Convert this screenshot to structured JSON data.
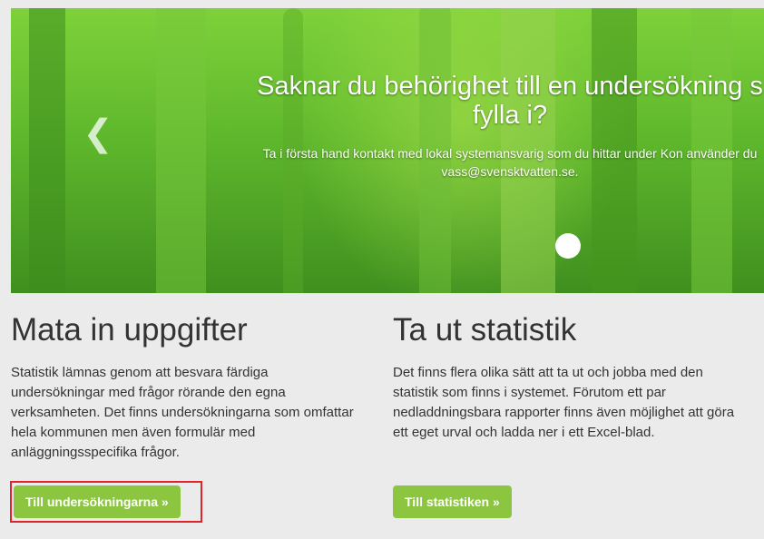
{
  "carousel": {
    "title": "Saknar du behörighet till en undersökning s fylla i?",
    "text": "Ta i första hand kontakt med lokal systemansvarig som du hittar under Kon använder du vass@svensktvatten.se."
  },
  "left": {
    "heading": "Mata in uppgifter",
    "body": "Statistik lämnas genom att besvara färdiga undersökningar med frågor rörande den egna verksamheten. Det finns undersökningarna som omfattar hela kommunen men även formulär med anläggningsspecifika frågor.",
    "button_label": "Till undersökningarna »"
  },
  "right": {
    "heading": "Ta ut statistik",
    "body": "Det finns flera olika sätt att ta ut och jobba med den statistik som finns i systemet. Förutom ett par nedladdningsbara rapporter finns även möjlighet att göra ett eget urval och ladda ner i ett Excel-blad.",
    "button_label": "Till statistiken »"
  },
  "colors": {
    "button": "#8cc641",
    "highlight": "#e0242c",
    "background": "#ebebeb"
  }
}
